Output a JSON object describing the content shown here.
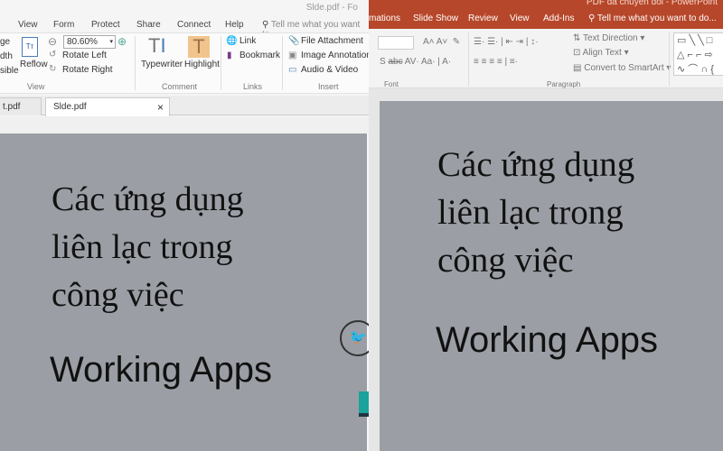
{
  "foxit": {
    "title": "Slde.pdf - Fo",
    "menu": [
      "View",
      "Form",
      "Protect",
      "Share",
      "Connect",
      "Help"
    ],
    "tell_me": "Tell me what you want to",
    "view_group": {
      "left_cut": [
        "ge",
        "dth",
        "sible"
      ],
      "reflow": "Reflow",
      "zoom": "80.60%",
      "rotate_left": "Rotate Left",
      "rotate_right": "Rotate Right",
      "label": "View"
    },
    "comment_group": {
      "typewriter": "Typewriter",
      "highlight": "Highlight",
      "label": "Comment"
    },
    "links_group": {
      "link": "Link",
      "bookmark": "Bookmark",
      "label": "Links"
    },
    "insert_group": {
      "file_attachment": "File Attachment",
      "image_annotation": "Image Annotation",
      "audio_video": "Audio & Video",
      "label": "Insert"
    },
    "tabs": [
      {
        "label": "t.pdf"
      },
      {
        "label": "Slde.pdf",
        "close": "×"
      }
    ],
    "slide": {
      "title_lines": [
        "Các ứng dụng",
        "liên lạc trong",
        "công việc"
      ],
      "subtitle": "Working Apps"
    }
  },
  "ppt": {
    "title": "PDF đã chuyển đổi - PowerPoint",
    "menu": [
      "mations",
      "Slide Show",
      "Review",
      "View",
      "Add-Ins"
    ],
    "tell_me": "Tell me what you want to do...",
    "font_label": "Font",
    "paragraph_label": "Paragraph",
    "text_direction": "Text Direction",
    "align_text": "Align Text",
    "convert_smartart": "Convert to SmartArt",
    "slide": {
      "title_lines": [
        "Các ứng dụng",
        "liên lạc trong",
        "công việc"
      ],
      "subtitle": "Working Apps"
    }
  }
}
